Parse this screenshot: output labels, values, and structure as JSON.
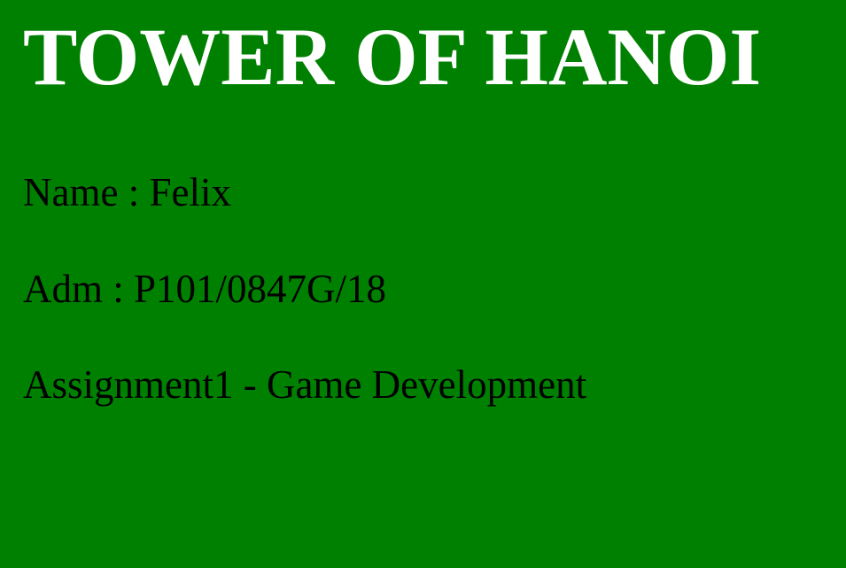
{
  "title": "TOWER OF HANOI",
  "info": {
    "name_line": "Name : Felix",
    "adm_line": "Adm : P101/0847G/18",
    "assignment_line": "Assignment1 - Game Development"
  },
  "colors": {
    "background": "#008000",
    "title_text": "#ffffff",
    "body_text": "#000000"
  }
}
